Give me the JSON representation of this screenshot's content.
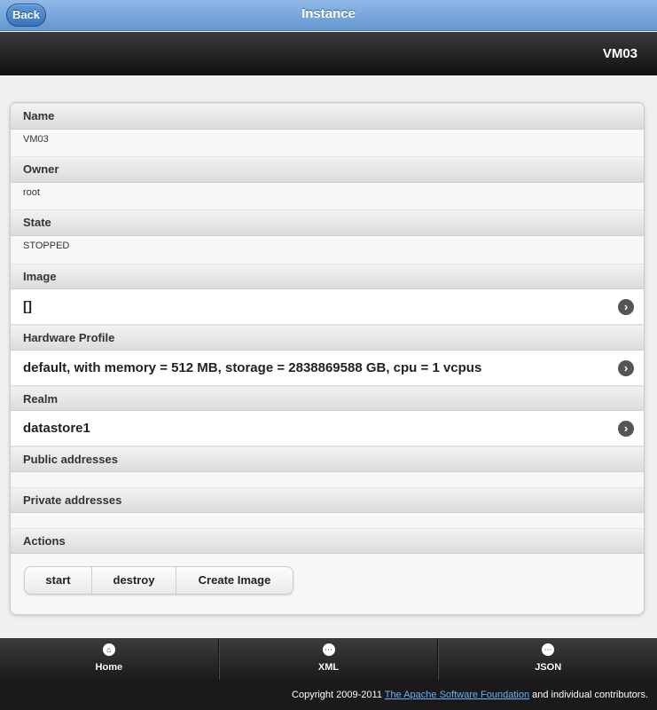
{
  "header": {
    "back_label": "Back",
    "title": "Instance"
  },
  "subheader": {
    "title": "VM03"
  },
  "details": {
    "name_label": "Name",
    "name_value": "VM03",
    "owner_label": "Owner",
    "owner_value": "root",
    "state_label": "State",
    "state_value": "STOPPED",
    "image_label": "Image",
    "image_value": "[]",
    "hardware_label": "Hardware Profile",
    "hardware_value": "default, with memory = 512 MB, storage = 2838869588 GB, cpu = 1 vcpus",
    "realm_label": "Realm",
    "realm_value": "datastore1",
    "public_label": "Public addresses",
    "private_label": "Private addresses",
    "actions_label": "Actions"
  },
  "actions": {
    "start": "start",
    "destroy": "destroy",
    "create_image": "Create Image"
  },
  "navbar": {
    "home": "Home",
    "xml": "XML",
    "json": "JSON"
  },
  "footer": {
    "prefix": "Copyright 2009-2011",
    "link": "The Apache Software Foundation",
    "suffix": "and individual contributors."
  },
  "colors": {
    "header_blue": "#6f9fd8",
    "back_button": "#3f7bc4",
    "dark_bar": "#1b1b1b",
    "footer_link": "#6faff5"
  },
  "icons": {
    "arrow": "chevron-right-icon",
    "home": "home-icon",
    "grid": "grid-icon"
  }
}
